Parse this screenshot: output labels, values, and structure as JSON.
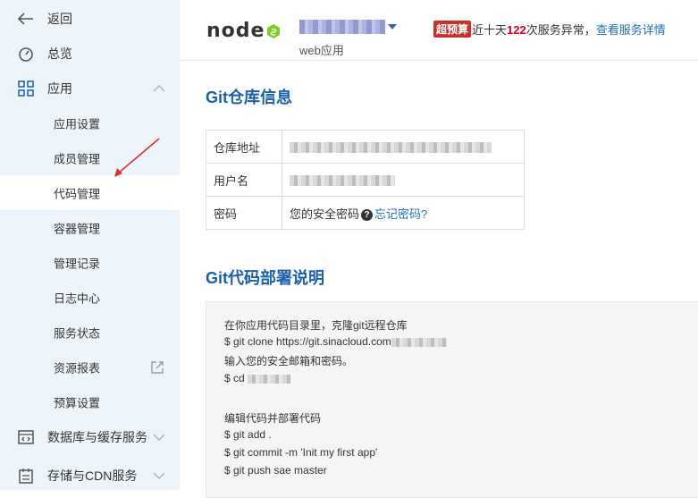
{
  "sidebar": {
    "back_label": "返回",
    "overview_label": "总览",
    "app_label": "应用",
    "sub_items": [
      "应用设置",
      "成员管理",
      "代码管理",
      "容器管理",
      "管理记录",
      "日志中心",
      "服务状态",
      "资源报表",
      "预算设置"
    ],
    "active_sub_item": "代码管理",
    "db_label": "数据库与缓存服务",
    "storage_label": "存储与CDN服务"
  },
  "header": {
    "logo_text": "node",
    "app_type": "web应用",
    "badge": "超预算",
    "notice_prefix": "近十天",
    "notice_count": "122",
    "notice_suffix": "次服务异常，",
    "notice_link": "查看服务详情"
  },
  "git_info": {
    "title": "Git仓库信息",
    "rows": [
      {
        "key": "仓库地址"
      },
      {
        "key": "用户名"
      },
      {
        "key": "密码",
        "value": "您的安全密码",
        "link": "忘记密码?"
      }
    ]
  },
  "deploy": {
    "title": "Git代码部署说明",
    "lines": [
      "在你应用代码目录里，克隆git远程仓库",
      "$ git clone https://git.sinacloud.com",
      "输入您的安全邮箱和密码。",
      "$ cd",
      "",
      "编辑代码并部署代码",
      "$ git add .",
      "$ git commit -m 'Init my first app'",
      "$ git push sae master"
    ]
  },
  "colors": {
    "accent": "#1a5fa8",
    "link": "#1f6fb5",
    "sidebar_bg": "#eef5fa",
    "badge": "#c9302c",
    "alert": "#d9001b"
  }
}
